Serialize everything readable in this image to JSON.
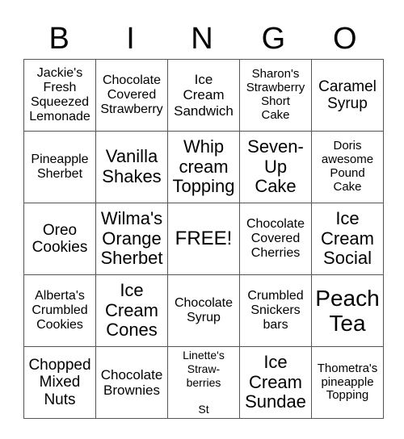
{
  "header": [
    "B",
    "I",
    "N",
    "G",
    "O"
  ],
  "grid": [
    [
      "Jackie's\nFresh\nSqueezed\nLemonade",
      "Chocolate\nCovered\nStrawberry",
      "Ice\nCream\nSandwich",
      "Sharon's\nStrawberry\nShort\nCake",
      "Caramel\nSyrup"
    ],
    [
      "Pineapple\nSherbet",
      "Vanilla\nShakes",
      "Whip\ncream\nTopping",
      "Seven-\nUp\nCake",
      "Doris\nawesome\nPound\nCake"
    ],
    [
      "Oreo\nCookies",
      "Wilma's\nOrange\nSherbet",
      "FREE!",
      "Chocolate\nCovered\nCherries",
      "Ice\nCream\nSocial"
    ],
    [
      "Alberta's\nCrumbled\nCookies",
      "Ice\nCream\nCones",
      "Chocolate\nSyrup",
      "Crumbled\nSnickers\nbars",
      "Peach\nTea"
    ],
    [
      "Chopped\nMixed\nNuts",
      "Chocolate\nBrownies",
      "Linette's\nStraw-\nberries\n\nSt",
      "Ice\nCream\nSundae",
      "Thometra's\npineapple\nTopping"
    ]
  ]
}
